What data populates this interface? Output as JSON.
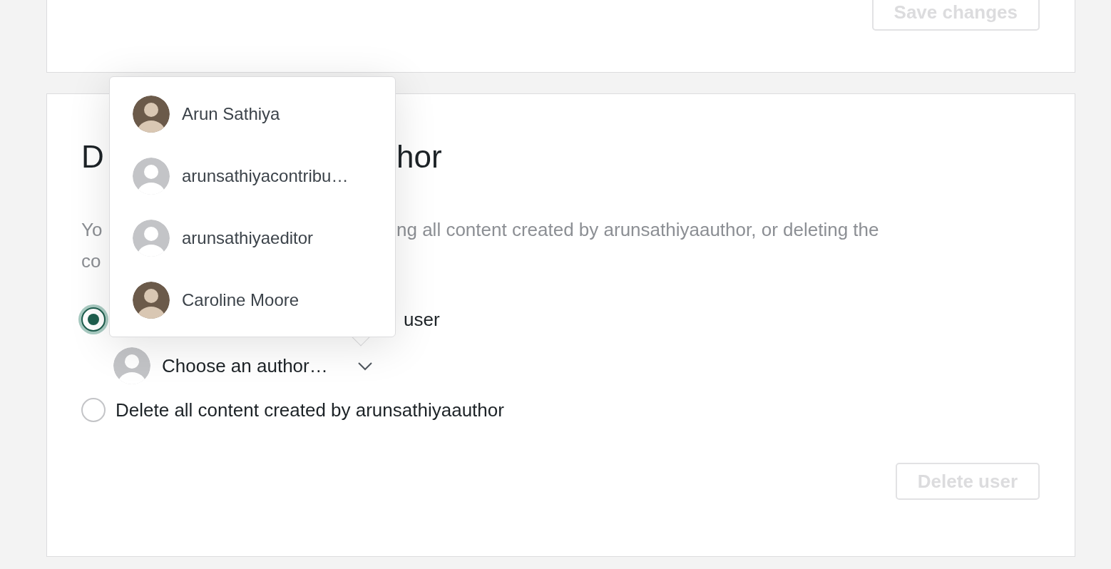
{
  "settings_card": {
    "save_button": {
      "label": "Save changes",
      "disabled": true
    }
  },
  "delete_card": {
    "heading_fragments": [
      "D",
      "hor"
    ],
    "description_lines": [
      [
        "Yo",
        "ng all content created by arunsathiyaauthor, or deleting the"
      ],
      [
        "co"
      ]
    ],
    "options": [
      {
        "kind": "attribute",
        "label": "user",
        "selected": true,
        "author_select": {
          "value": "Choose an author…"
        }
      },
      {
        "kind": "delete",
        "label": "Delete all content created by arunsathiyaauthor",
        "selected": false
      }
    ],
    "delete_button": {
      "label": "Delete user",
      "disabled": true
    }
  },
  "author_dropdown": {
    "open": true,
    "items": [
      {
        "name": "Arun Sathiya",
        "has_photo": true
      },
      {
        "name": "arunsathiyacontribu…",
        "has_photo": false
      },
      {
        "name": "arunsathiyaeditor",
        "has_photo": false
      },
      {
        "name": "Caroline Moore",
        "has_photo": true
      }
    ]
  }
}
